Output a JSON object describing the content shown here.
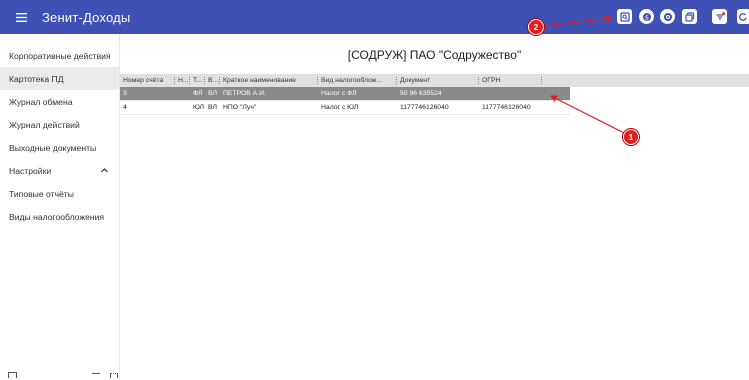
{
  "header": {
    "menu_icon": "hamburger-icon",
    "title": "Зенит-Доходы",
    "buttons": [
      "search-doc-icon",
      "dollar-icon",
      "settings-icon",
      "copy-icon",
      "filter-icon",
      "refresh-icon"
    ]
  },
  "sidebar": {
    "items": [
      {
        "label": "Корпоративные действия"
      },
      {
        "label": "Картотека ПД",
        "active": true
      },
      {
        "label": "Журнал обмена"
      },
      {
        "label": "Журнал действий"
      },
      {
        "label": "Выходные документы"
      },
      {
        "label": "Настройки",
        "expanded": true
      },
      {
        "label": "Типовые отчёты"
      },
      {
        "label": "Виды налогообложения"
      }
    ]
  },
  "main": {
    "title": "[СОДРУЖ] ПАО \"Содружество\"",
    "table": {
      "columns": [
        "Номер счёта",
        "Н...",
        "Т...",
        "В...",
        "Краткое наименование",
        "Вид налогооблож...",
        "Документ",
        "ОГРН"
      ],
      "rows": [
        [
          "3",
          "",
          "ФЛ",
          "ВЛ",
          "ПЕТРОВ А.И.",
          "Налог с ФЛ",
          "50 96 635524",
          ""
        ],
        [
          "4",
          "",
          "ЮЛ",
          "ВЛ",
          "НПО \"Луч\"",
          "Налог с ЮЛ",
          "1177746126040",
          "1177746126040"
        ]
      ]
    }
  },
  "annotations": [
    {
      "label": "1"
    },
    {
      "label": "2"
    }
  ],
  "colors": {
    "header": "#3f51b5",
    "annotation": "#e02020",
    "selected_row": "#8a8a8a"
  }
}
